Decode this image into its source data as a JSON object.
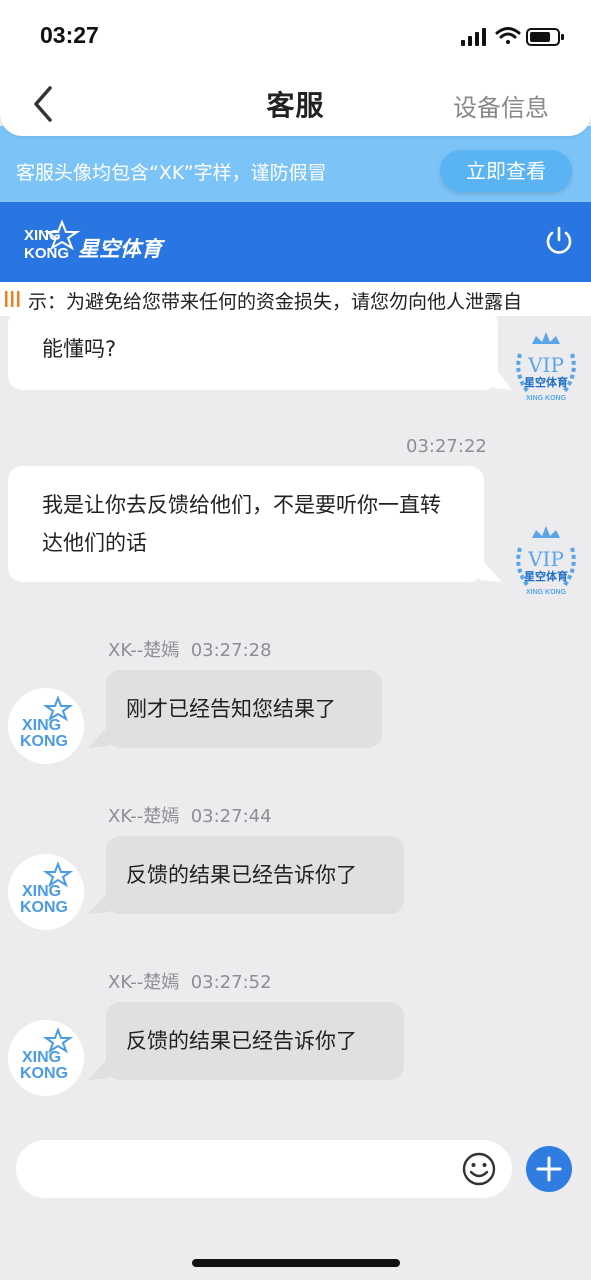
{
  "status": {
    "time": "03:27"
  },
  "nav": {
    "title": "客服",
    "right_label": "设备信息"
  },
  "notice": {
    "text": "客服头像均包含“XK”字样，谨防假冒",
    "button_label": "立即查看"
  },
  "brand": {
    "logo_latin_top": "XING",
    "logo_latin_bottom": "KONG",
    "logo_cn": "星空体育"
  },
  "marquee": {
    "text": "示：为避免给您带来任何的资金损失，请您勿向他人泄露自"
  },
  "messages": [
    {
      "side": "right",
      "line1": "能懂吗?",
      "line2": ""
    },
    {
      "side": "right",
      "time": "03:27:22",
      "line1": "我是让你去反馈给他们，不是要听你一直转",
      "line2": "达他们的话"
    },
    {
      "side": "left",
      "sender": "XK--楚嫣",
      "time": "03:27:28",
      "text": "刚才已经告知您结果了"
    },
    {
      "side": "left",
      "sender": "XK--楚嫣",
      "time": "03:27:44",
      "text": "反馈的结果已经告诉你了"
    },
    {
      "side": "left",
      "sender": "XK--楚嫣",
      "time": "03:27:52",
      "text": "反馈的结果已经告诉你了"
    }
  ],
  "avatars": {
    "vip_label": "VIP",
    "vip_brand": "星空体育",
    "vip_sub": "XING KONG",
    "agent_top": "XING",
    "agent_bottom": "KONG"
  },
  "input": {
    "placeholder": ""
  },
  "colors": {
    "brand_blue": "#2976e2",
    "notice_bg": "#7cc3f7",
    "chat_bg": "#ececee",
    "agent_bubble": "#e0e0e3"
  }
}
